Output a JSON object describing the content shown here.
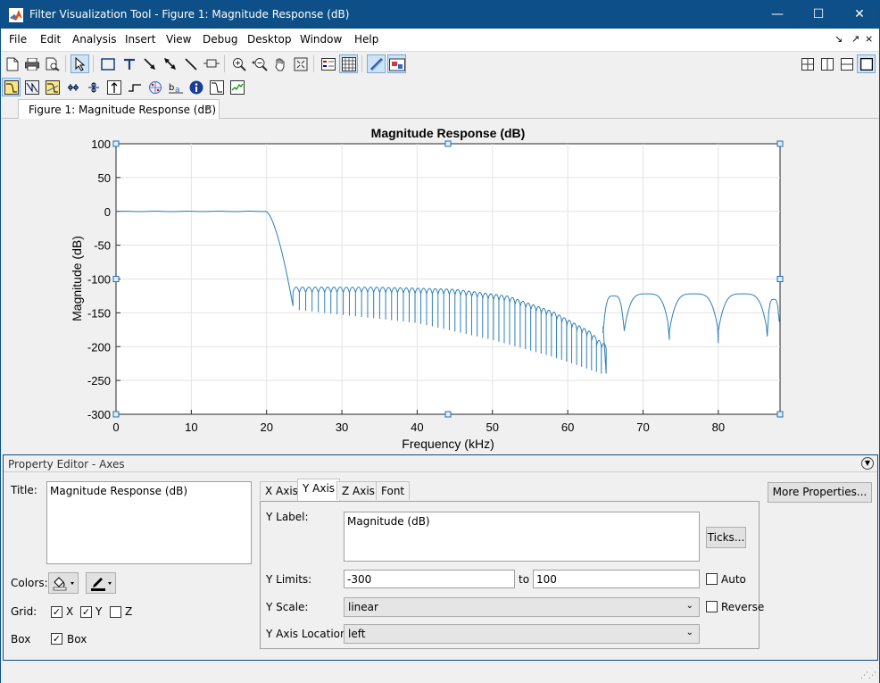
{
  "window": {
    "title": "Filter Visualization Tool - Figure 1: Magnitude Response (dB)",
    "minimize": "—",
    "maximize": "☐",
    "close": "✕"
  },
  "menu": {
    "items": [
      "File",
      "Edit",
      "Analysis",
      "Insert",
      "View",
      "Debug",
      "Desktop",
      "Window",
      "Help"
    ],
    "right_icons": [
      "↘",
      "↗",
      "⨯"
    ]
  },
  "figure_tab": {
    "label": "Figure 1: Magnitude Response (dB)",
    "close": "✕"
  },
  "chart_data": {
    "type": "line",
    "title": "Magnitude Response (dB)",
    "xlabel": "Frequency (kHz)",
    "ylabel": "Magnitude (dB)",
    "xlim": [
      0,
      88.2
    ],
    "ylim": [
      -300,
      100
    ],
    "xticks": [
      0,
      10,
      20,
      30,
      40,
      50,
      60,
      70,
      80
    ],
    "yticks": [
      100,
      50,
      0,
      -50,
      -100,
      -150,
      -200,
      -250,
      -300
    ],
    "grid": true,
    "color": "#2e7fb8",
    "series": [
      {
        "description": "lowpass magnitude response",
        "passband": {
          "from_khz": 0,
          "to_khz": 19.9,
          "level_db": 0
        },
        "transition": {
          "from_khz": 19.9,
          "to_khz": 23.5,
          "to_db": -140
        },
        "stopband_lobe_envelope": [
          [
            23.5,
            -112
          ],
          [
            35,
            -112
          ],
          [
            45,
            -115
          ],
          [
            52,
            -125
          ],
          [
            58,
            -148
          ],
          [
            63,
            -178
          ],
          [
            64.5,
            -195
          ]
        ],
        "stopband_null_depth_db": [
          [
            23.5,
            -145
          ],
          [
            40,
            -165
          ],
          [
            50,
            -190
          ],
          [
            58,
            -215
          ],
          [
            64.5,
            -240
          ]
        ],
        "upper_lobe_centers_khz": [
          66,
          70.5,
          77,
          83.5,
          87.5
        ],
        "upper_lobe_peaks_db": [
          -125,
          -122,
          -122,
          -122,
          -130
        ],
        "upper_null_khz": [
          67.5,
          73.5,
          80,
          86.5
        ],
        "upper_null_db": [
          -175,
          -190,
          -195,
          -185
        ]
      }
    ]
  },
  "property_editor": {
    "header": "Property Editor - Axes",
    "title_label": "Title:",
    "title_value": "Magnitude Response (dB)",
    "colors_label": "Colors:",
    "grid_label": "Grid:",
    "grid_x": "X",
    "grid_y": "Y",
    "grid_z": "Z",
    "grid_x_checked": true,
    "grid_y_checked": true,
    "grid_z_checked": false,
    "box_label": "Box",
    "box_check_label": "Box",
    "box_checked": true,
    "tabs": [
      "X Axis",
      "Y Axis",
      "Z Axis",
      "Font"
    ],
    "selected_tab": "Y Axis",
    "y_label_label": "Y Label:",
    "y_label_value": "Magnitude (dB)",
    "ticks_button": "Ticks...",
    "y_limits_label": "Y Limits:",
    "y_limit_min": "-300",
    "to_label": "to",
    "y_limit_max": "100",
    "auto_label": "Auto",
    "auto_checked": false,
    "y_scale_label": "Y Scale:",
    "y_scale_value": "linear",
    "reverse_label": "Reverse",
    "reverse_checked": false,
    "y_axis_location_label": "Y Axis Location:",
    "y_axis_location_value": "left",
    "more_properties_button": "More Properties..."
  }
}
